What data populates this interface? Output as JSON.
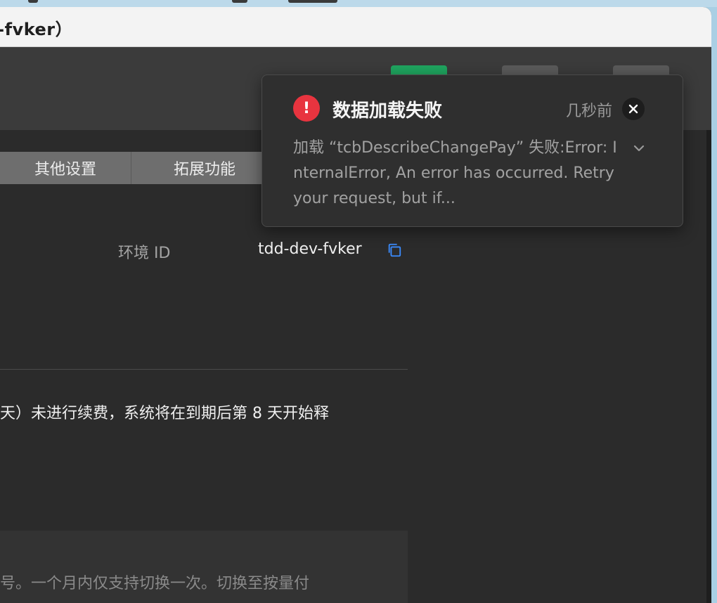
{
  "window": {
    "title": "v-fvker）"
  },
  "tabs": [
    {
      "label": "其他设置"
    },
    {
      "label": "拓展功能"
    }
  ],
  "environment": {
    "label": "环境 ID",
    "value": "tdd-dev-fvker"
  },
  "notice": {
    "text": "天）未进行续费，系统将在到期后第 8 天开始释"
  },
  "info": {
    "text": "号。一个月内仅支持切换一次。切换至按量付"
  },
  "toast": {
    "title": "数据加载失败",
    "time": "几秒前",
    "message": "加载 “tcbDescribeChangePay” 失败:Error: InternalError, An error has occurred. Retry your request, but if...",
    "icon": "error-icon"
  },
  "colors": {
    "error": "#e8343f",
    "link": "#3b8cff",
    "green_button": "#1fa45f"
  }
}
